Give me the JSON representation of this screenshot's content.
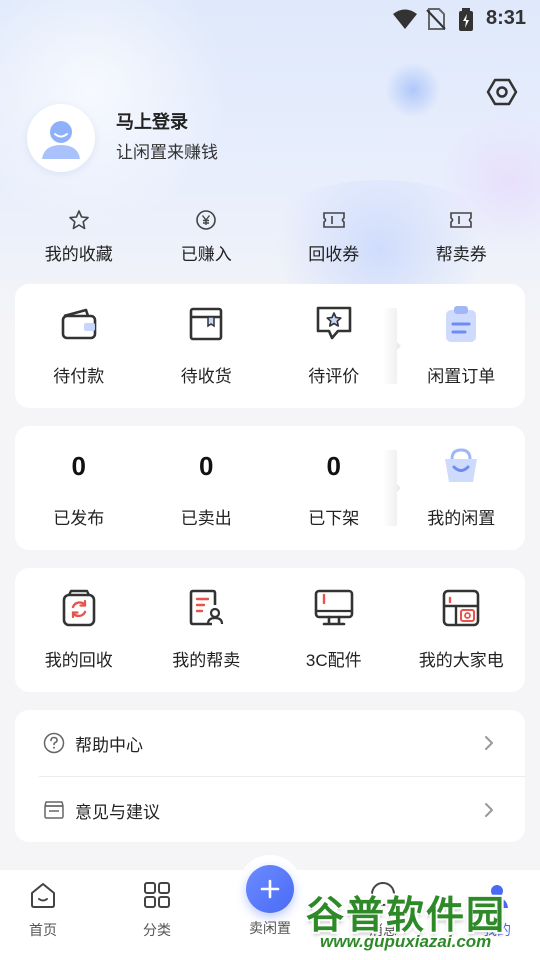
{
  "status_bar": {
    "time": "8:31"
  },
  "profile": {
    "title": "马上登录",
    "subtitle": "让闲置来赚钱"
  },
  "quick_links": [
    {
      "label": "我的收藏",
      "icon": "star-icon"
    },
    {
      "label": "已赚入",
      "icon": "yen-coin-icon"
    },
    {
      "label": "回收券",
      "icon": "ticket-icon"
    },
    {
      "label": "帮卖券",
      "icon": "ticket-icon"
    }
  ],
  "orders": [
    {
      "label": "待付款",
      "icon": "wallet-icon"
    },
    {
      "label": "待收货",
      "icon": "package-box-icon"
    },
    {
      "label": "待评价",
      "icon": "review-star-bubble-icon"
    },
    {
      "label": "闲置订单",
      "icon": "clipboard-icon"
    }
  ],
  "my_items": [
    {
      "count": "0",
      "label": "已发布"
    },
    {
      "count": "0",
      "label": "已卖出"
    },
    {
      "count": "0",
      "label": "已下架"
    }
  ],
  "my_idle": {
    "label": "我的闲置",
    "icon": "shopping-bag-smile-icon"
  },
  "services": [
    {
      "label": "我的回收",
      "icon": "recycle-box-icon"
    },
    {
      "label": "我的帮卖",
      "icon": "document-user-icon"
    },
    {
      "label": "3C配件",
      "icon": "monitor-icon"
    },
    {
      "label": "我的大家电",
      "icon": "appliance-icon"
    }
  ],
  "menu": [
    {
      "label": "帮助中心",
      "icon": "question-circle-icon"
    },
    {
      "label": "意见与建议",
      "icon": "feedback-box-icon"
    }
  ],
  "tabbar": {
    "home": "首页",
    "category": "分类",
    "sell": "卖闲置",
    "messages": "消息",
    "mine": "我的"
  },
  "watermark": {
    "title": "谷普软件园",
    "url": "www.gupuxiazai.com"
  },
  "colors": {
    "accent": "#4a6af5",
    "watermark_green": "#2e8a28",
    "recycle_red": "#e8534b"
  }
}
